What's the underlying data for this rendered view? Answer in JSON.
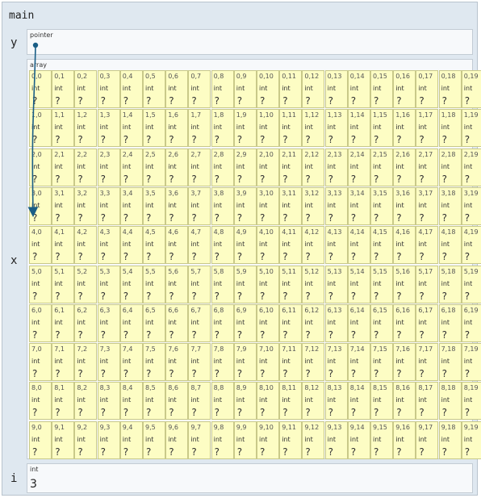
{
  "frame": {
    "title": "main"
  },
  "variables": {
    "y": {
      "name": "y",
      "type": "pointer"
    },
    "x": {
      "name": "x",
      "type": "array",
      "rows": 10,
      "cols": 20,
      "element_type": "int",
      "element_value": "?"
    },
    "i": {
      "name": "i",
      "type": "int",
      "value": "3"
    }
  },
  "pointer_target": {
    "row": 3,
    "col": 0
  },
  "colors": {
    "cell_bg": "#fdfdc4",
    "cell_border": "#c9c989",
    "frame_bg": "#dfe8f0",
    "arrow": "#1a5e86"
  }
}
